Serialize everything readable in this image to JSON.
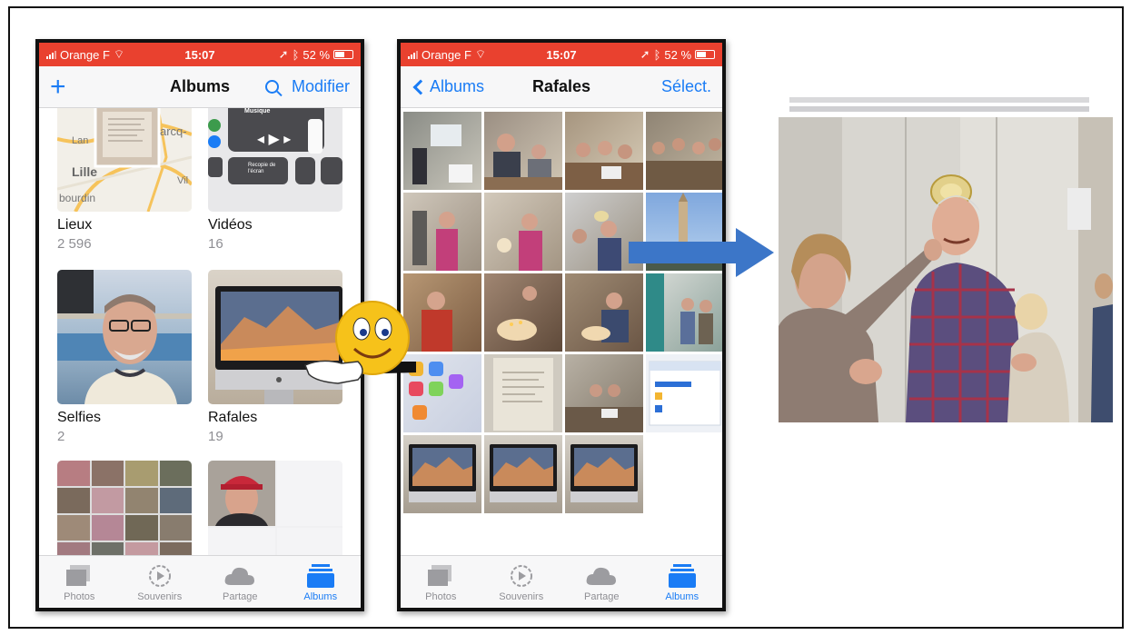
{
  "status": {
    "carrier": "Orange F",
    "time": "15:07",
    "battery": "52 %"
  },
  "albums_screen": {
    "title": "Albums",
    "add": "+",
    "edit": "Modifier",
    "places_map": {
      "lan": "Lan",
      "arcq": "arcq-",
      "lille": "Lille",
      "vil": "Vil",
      "bourdin": "bourdin"
    },
    "videos_panel": {
      "music": "Musique",
      "recopie": "Recopie de l'écran"
    },
    "albums": [
      {
        "name": "Lieux",
        "count": "2 596"
      },
      {
        "name": "Vidéos",
        "count": "16"
      },
      {
        "name": "Selfies",
        "count": "2"
      },
      {
        "name": "Rafales",
        "count": "19"
      }
    ]
  },
  "burst_screen": {
    "back": "Albums",
    "title": "Rafales",
    "select": "Sélect."
  },
  "tabs": [
    "Photos",
    "Souvenirs",
    "Partage",
    "Albums"
  ],
  "colors": {
    "status": "#e9412f",
    "accent": "#1a7cf5",
    "arrow": "#3c76c8"
  }
}
